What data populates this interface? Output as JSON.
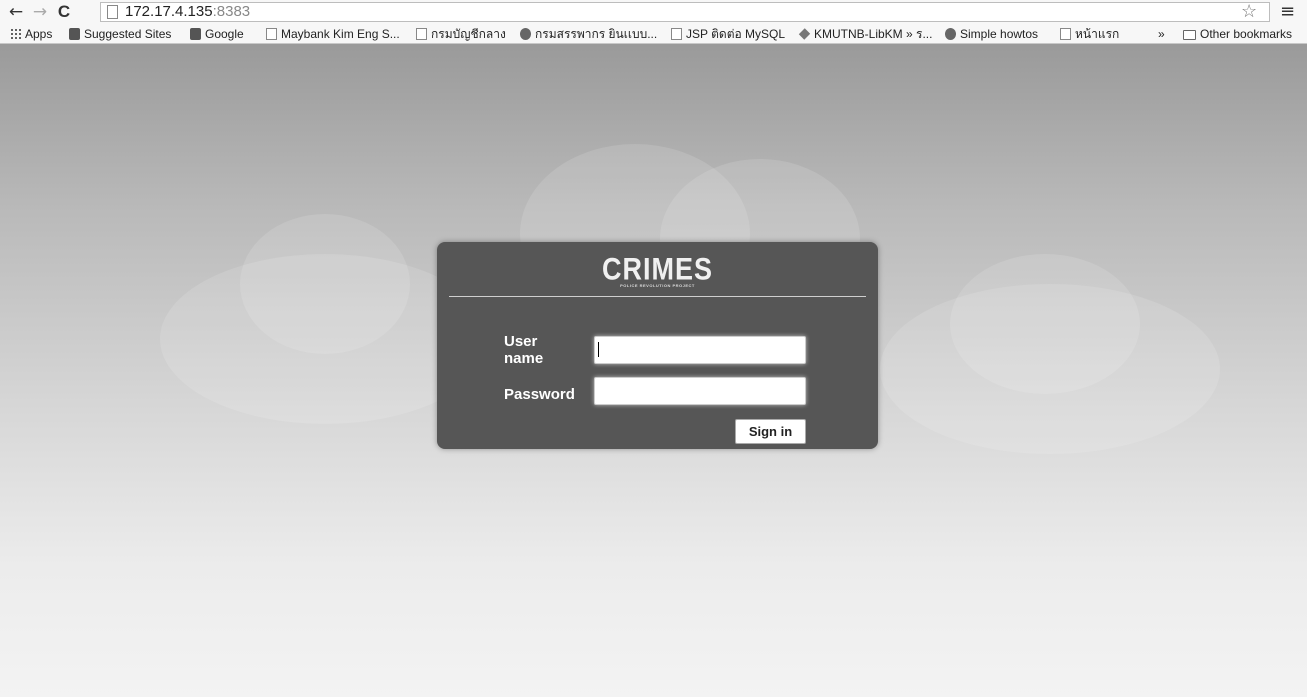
{
  "browser": {
    "url_host": "172.17.4.135",
    "url_port": ":8383",
    "back_icon": "←",
    "forward_icon": "→",
    "reload_icon": "C",
    "star_icon": "☆",
    "menu_icon": "≡"
  },
  "bookmarks": {
    "apps": "Apps",
    "items": [
      "Suggested Sites",
      "Google",
      "Maybank Kim Eng S...",
      "กรมบัญชีกลาง",
      "กรมสรรพากร ยินเเบบ...",
      "JSP ติดต่อ MySQL",
      "KMUTNB-LibKM » ร...",
      "Simple howtos",
      "หน้าแรก"
    ],
    "overflow": "»",
    "other": "Other bookmarks"
  },
  "login": {
    "logo": "CRIMES",
    "logo_sub": "POLICE REVOLUTION PROJECT",
    "username_label": "User name",
    "password_label": "Password",
    "username_value": "",
    "password_value": "",
    "signin_label": "Sign in"
  }
}
